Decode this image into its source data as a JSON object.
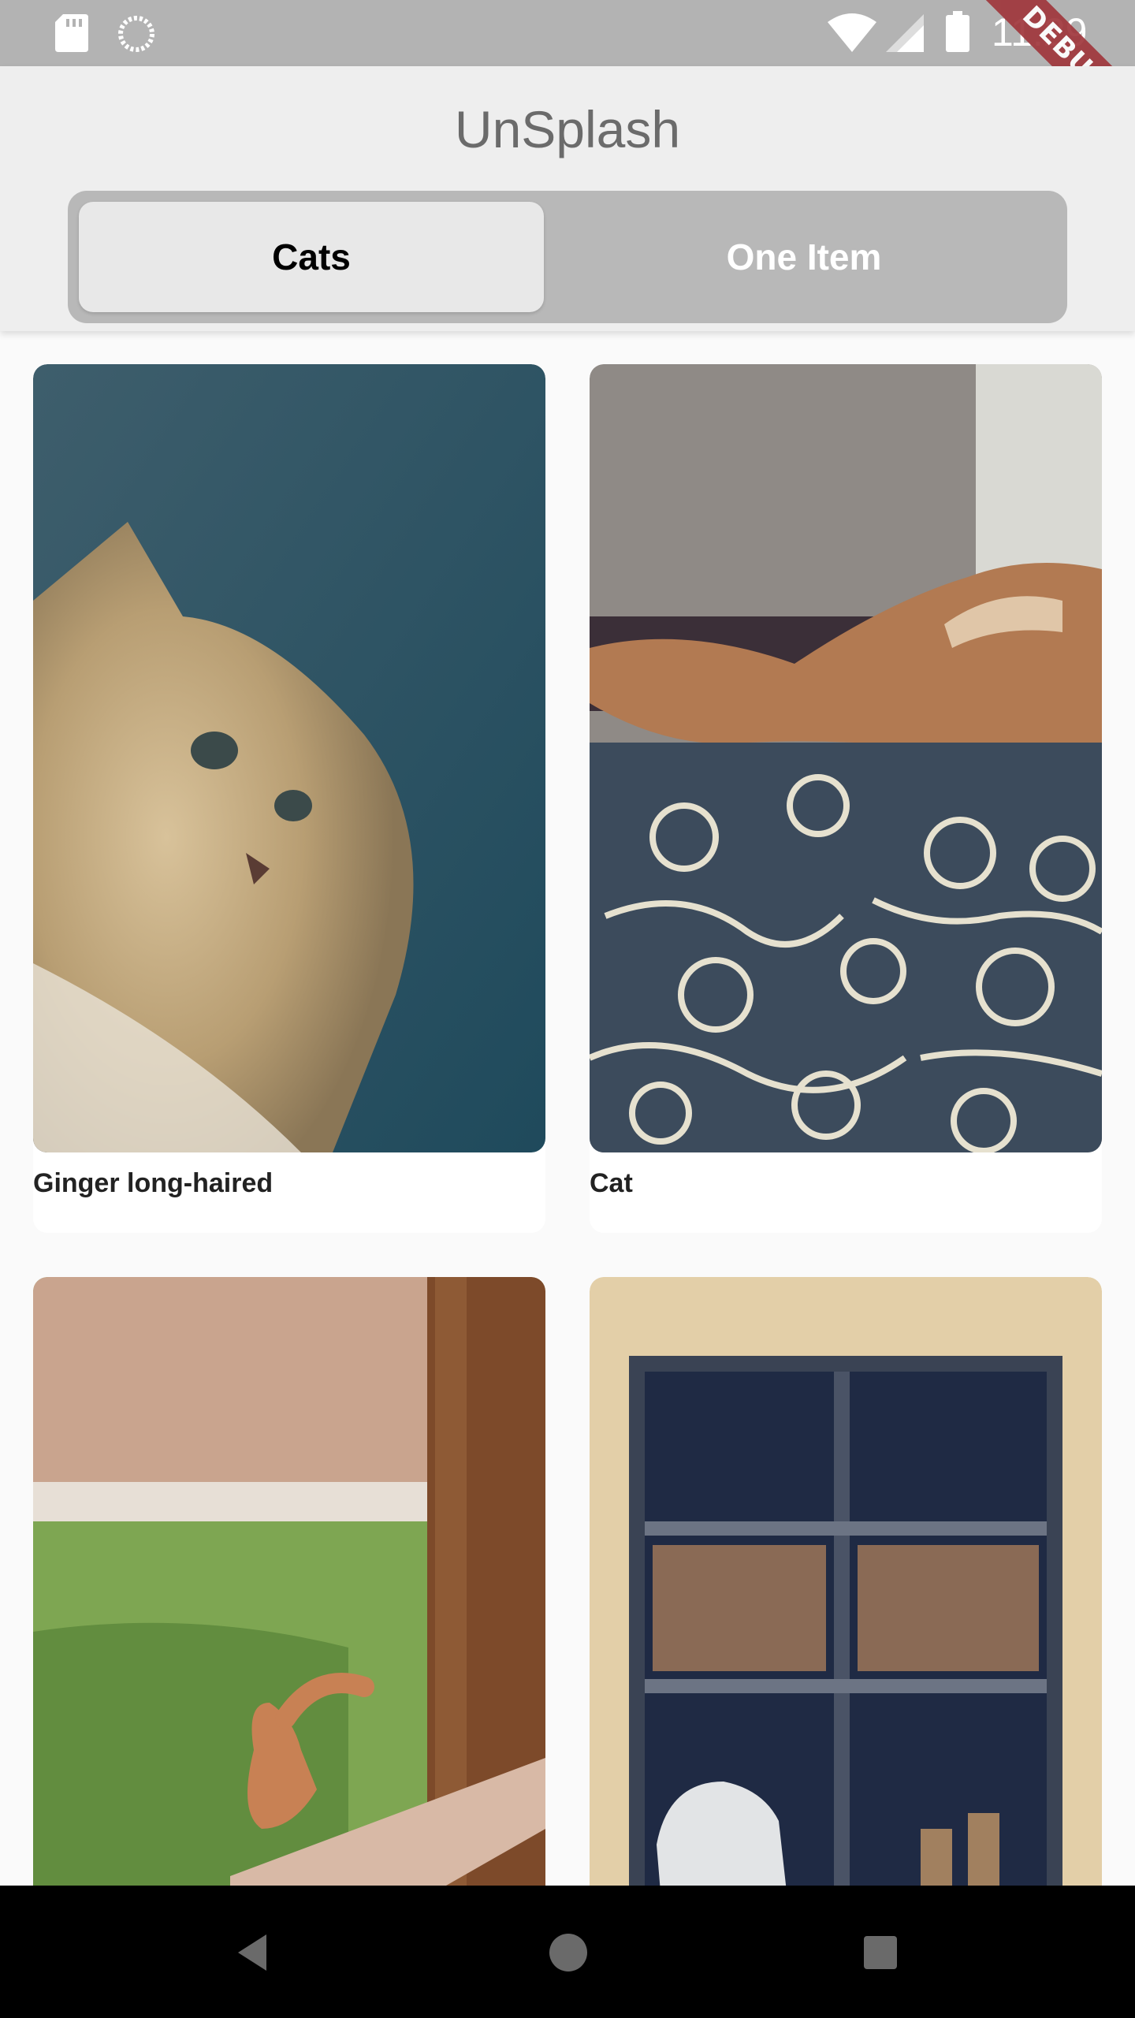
{
  "status_bar": {
    "time": "11:29",
    "icons": [
      "sd-card-icon",
      "sync-icon",
      "wifi-icon",
      "signal-icon",
      "battery-icon"
    ]
  },
  "debug_banner": "DEBUG",
  "app_bar": {
    "title": "UnSplash"
  },
  "segmented_control": {
    "tabs": [
      {
        "label": "Cats",
        "selected": true
      },
      {
        "label": "One Item",
        "selected": false
      }
    ]
  },
  "cards": [
    {
      "caption": "Ginger long-haired",
      "image": "long-haired ginger cat against teal background"
    },
    {
      "caption": "Cat",
      "image": "ginger cat sleeping on floral blanket"
    },
    {
      "caption": "",
      "image": "ginger cat behind wooden fence in grass"
    },
    {
      "caption": "",
      "image": "white cat in window"
    }
  ],
  "nav_bar": {
    "buttons": [
      "back-icon",
      "home-icon",
      "recents-icon"
    ]
  },
  "colors": {
    "status_bar": "#b3b3b3",
    "app_bar": "#eeeeee",
    "segment_track": "#b8b8b8",
    "segment_active": "#e8e8e8",
    "debug_ribbon": "#a0373c"
  }
}
